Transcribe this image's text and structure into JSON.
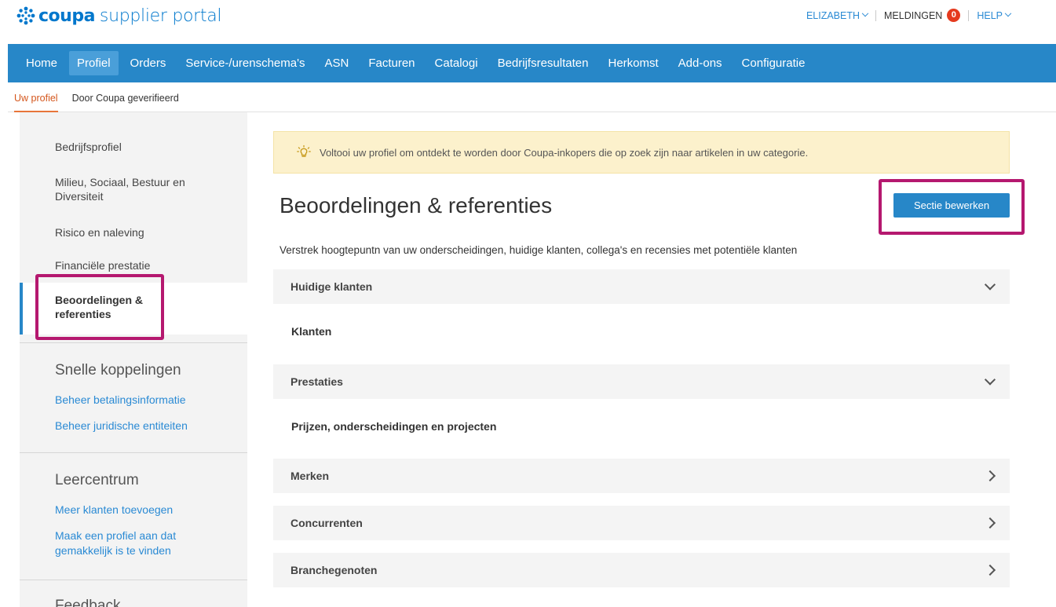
{
  "header": {
    "logo_brand": "coupa",
    "logo_product": "supplier portal",
    "user_label": "ELIZABETH",
    "notifications_label": "MELDINGEN",
    "notifications_count": "0",
    "help_label": "HELP"
  },
  "nav": {
    "items": [
      "Home",
      "Profiel",
      "Orders",
      "Service-/urenschema's",
      "ASN",
      "Facturen",
      "Catalogi",
      "Bedrijfsresultaten",
      "Herkomst",
      "Add-ons",
      "Configuratie"
    ],
    "active": "Profiel"
  },
  "subnav": {
    "items": [
      "Uw profiel",
      "Door Coupa geverifieerd"
    ],
    "active": "Uw profiel"
  },
  "sidebar": {
    "items": [
      "Bedrijfsprofiel",
      "Milieu, Sociaal, Bestuur en Diversiteit",
      "Risico en naleving",
      "Financiële prestatie",
      "Beoordelingen & referenties"
    ],
    "active_item": "Beoordelingen & referenties",
    "quick_links": {
      "heading": "Snelle koppelingen",
      "links": [
        "Beheer betalingsinformatie",
        "Beheer juridische entiteiten"
      ]
    },
    "learning": {
      "heading": "Leercentrum",
      "links": [
        "Meer klanten toevoegen",
        "Maak een profiel aan dat gemakkelijk is te vinden"
      ]
    },
    "feedback_heading": "Feedback"
  },
  "main": {
    "notice": "Voltooi uw profiel om ontdekt te worden door Coupa-inkopers die op zoek zijn naar artikelen in uw categorie.",
    "title": "Beoordelingen & referenties",
    "edit_button": "Sectie bewerken",
    "description": "Verstrek hoogtepuntn van uw onderscheidingen, huidige klanten, collega's en recensies met potentiële klanten",
    "sections": [
      {
        "title": "Huidige klanten",
        "expanded": true,
        "content": "Klanten"
      },
      {
        "title": "Prestaties",
        "expanded": true,
        "content": "Prijzen, onderscheidingen en projecten"
      },
      {
        "title": "Merken",
        "expanded": false
      },
      {
        "title": "Concurrenten",
        "expanded": false
      },
      {
        "title": "Branchegenoten",
        "expanded": false
      }
    ]
  },
  "colors": {
    "primary": "#2787c8",
    "highlight": "#b5186f",
    "active_tab": "#e8753a",
    "notice_bg": "#fcf1cc",
    "badge": "#e53a1e"
  }
}
